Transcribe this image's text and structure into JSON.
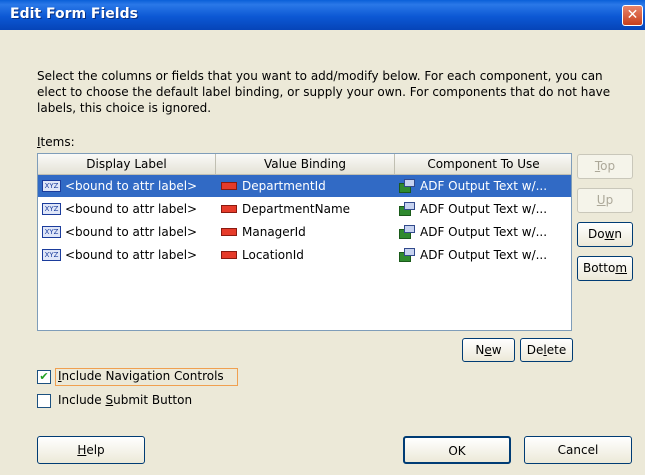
{
  "dialog": {
    "title": "Edit Form Fields",
    "close_glyph": "✕"
  },
  "description": "Select the columns or fields that you want to add/modify below. For each component, you can elect to choose the default label binding, or supply your own. For components that do not have labels, this choice is ignored.",
  "items_label_hotkey": "I",
  "items_label_rest": "tems:",
  "table": {
    "columns": [
      "Display Label",
      "Value Binding",
      "Component To Use"
    ],
    "rows": [
      {
        "label": "<bound to attr label>",
        "binding": "DepartmentId",
        "component": "ADF Output Text w/...",
        "selected": true
      },
      {
        "label": "<bound to attr label>",
        "binding": "DepartmentName",
        "component": "ADF Output Text w/...",
        "selected": false
      },
      {
        "label": "<bound to attr label>",
        "binding": "ManagerId",
        "component": "ADF Output Text w/...",
        "selected": false
      },
      {
        "label": "<bound to attr label>",
        "binding": "LocationId",
        "component": "ADF Output Text w/...",
        "selected": false
      }
    ],
    "label_icon": "xyz-text-icon",
    "binding_icon": "attribute-binding-icon",
    "component_icon": "adf-component-icon"
  },
  "side_buttons": {
    "top": {
      "hot": "T",
      "rest": "op"
    },
    "up": {
      "hot": "U",
      "rest": "p"
    },
    "down": {
      "pre": "Do",
      "hot": "w",
      "rest": "n"
    },
    "bottom": {
      "pre": "Botto",
      "hot": "m",
      "rest": ""
    }
  },
  "new_button": {
    "pre": "N",
    "hot": "e",
    "rest": "w"
  },
  "delete_button": {
    "pre": "De",
    "hot": "l",
    "rest": "ete"
  },
  "include_nav": {
    "hot": "I",
    "rest": "nclude Navigation Controls",
    "checked": true
  },
  "include_submit": {
    "pre": "Include ",
    "hot": "S",
    "rest": "ubmit Button",
    "checked": false
  },
  "footer": {
    "help": {
      "hot": "H",
      "rest": "elp"
    },
    "ok": "OK",
    "cancel": "Cancel"
  },
  "check_glyph": "✔"
}
